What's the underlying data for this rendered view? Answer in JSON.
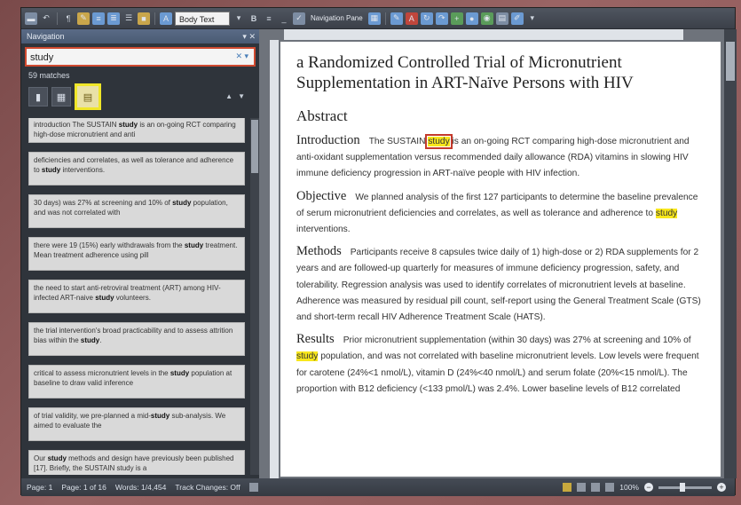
{
  "ribbon": {
    "style_value": "Body Text",
    "navigation_pane_label": "Navigation Pane"
  },
  "nav": {
    "title": "Navigation",
    "search_value": "study",
    "matches": "59 matches",
    "results": [
      {
        "before": "introduction The SUSTAIN ",
        "hit": "study",
        "after": " is an on-going RCT comparing high-dose micronutrient and anti"
      },
      {
        "before": "deficiencies and correlates, as well as tolerance and adherence to ",
        "hit": "study",
        "after": " interventions."
      },
      {
        "before": "30 days) was 27% at screening and 10% of ",
        "hit": "study",
        "after": " population, and was not correlated with"
      },
      {
        "before": "there were 19 (15%) early withdrawals from the ",
        "hit": "study",
        "after": " treatment. Mean treatment adherence using pill"
      },
      {
        "before": "the need to start anti-retroviral treatment (ART) among HIV-infected ART-naive ",
        "hit": "study",
        "after": " volunteers."
      },
      {
        "before": "the trial intervention's broad practicability and to assess attrition bias within the ",
        "hit": "study",
        "after": "."
      },
      {
        "before": "critical to assess micronutrient levels in the ",
        "hit": "study",
        "after": " population at baseline to draw valid inference"
      },
      {
        "before": "of trial validity, we pre-planned a mid-",
        "hit": "study",
        "after": " sub-analysis. We aimed to evaluate the"
      },
      {
        "before": "Our ",
        "hit": "study",
        "after": " methods and design have previously been published [17]. Briefly, the SUSTAIN study is a"
      }
    ]
  },
  "document": {
    "title": "a Randomized Controlled Trial of Micronutrient Supplementation in ART-Naïve Persons with HIV",
    "abstract_heading": "Abstract",
    "sections": [
      {
        "heading": "Introduction",
        "before": "The SUSTAIN ",
        "hit": "study",
        "after": " is an on-going RCT comparing high-dose micronutrient and anti-oxidant supplementation versus recommended daily allowance (RDA) vitamins in slowing HIV immune deficiency progression in ART-naïve people with HIV infection."
      },
      {
        "heading": "Objective",
        "before": "We planned analysis of the first 127 participants to determine the baseline prevalence of serum micronutrient deficiencies and correlates, as well as tolerance and adherence to ",
        "hit": "study",
        "after": " interventions."
      },
      {
        "heading": "Methods",
        "before": "Participants receive 8 capsules twice daily of 1) high-dose or 2) RDA supplements for 2 years and are followed-up quarterly for measures of immune deficiency progression, safety, and tolerability. Regression analysis was used to identify correlates of micronutrient levels at baseline. Adherence was measured by residual pill count, self-report using the General Treatment Scale (GTS) and short-term recall HIV Adherence Treatment Scale (HATS).",
        "hit": "",
        "after": ""
      },
      {
        "heading": "Results",
        "before": "Prior micronutrient supplementation (within 30 days) was 27% at screening and 10% of ",
        "hit": "study",
        "after": " population, and was not correlated with baseline micronutrient levels. Low levels were frequent for carotene (24%<1 nmol/L), vitamin D (24%<40 nmol/L) and serum folate (20%<15 nmol/L). The proportion with B12 deficiency (<133 pmol/L) was 2.4%. Lower baseline levels of B12 correlated"
      }
    ]
  },
  "status": {
    "page": "Page: 1",
    "page_of": "Page: 1 of 16",
    "words": "Words: 1/4,454",
    "track_changes": "Track Changes: Off",
    "zoom": "100%"
  }
}
